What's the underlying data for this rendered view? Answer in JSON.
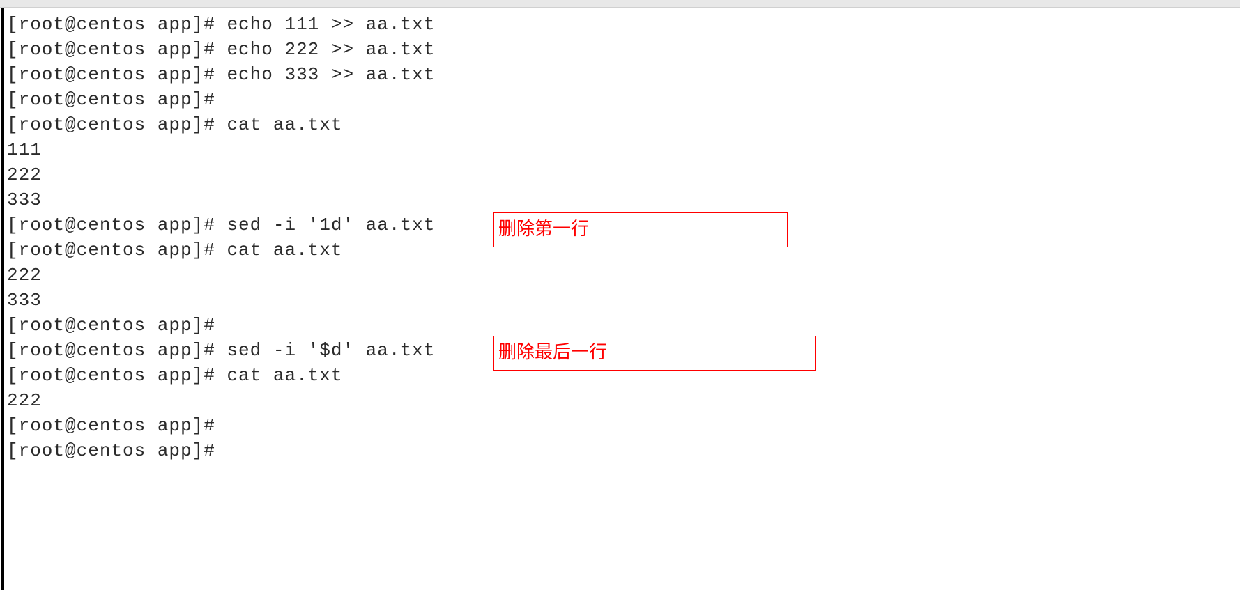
{
  "terminal": {
    "prompt": "[root@centos app]#",
    "lines": [
      "[root@centos app]# echo 111 >> aa.txt",
      "[root@centos app]# echo 222 >> aa.txt",
      "[root@centos app]# echo 333 >> aa.txt",
      "[root@centos app]# ",
      "[root@centos app]# cat aa.txt",
      "111",
      "222",
      "333",
      "[root@centos app]# sed -i '1d' aa.txt",
      "[root@centos app]# cat aa.txt",
      "222",
      "333",
      "[root@centos app]# ",
      "[root@centos app]# sed -i '$d' aa.txt",
      "[root@centos app]# cat aa.txt",
      "222",
      "[root@centos app]# ",
      "[root@centos app]# "
    ]
  },
  "annotations": {
    "a1": "删除第一行",
    "a2": "删除最后一行"
  }
}
